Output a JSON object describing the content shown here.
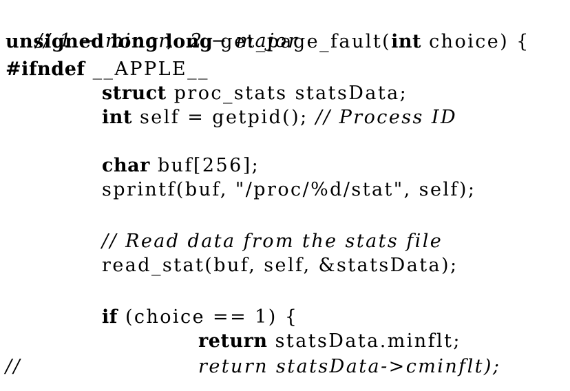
{
  "code": {
    "l1": {
      "comment": "// 1 − minor,  2 − major"
    },
    "l2": {
      "kw1": "unsigned long long",
      "rest": " get_page_fault(",
      "kw2": "int",
      "rest2": " choice) {"
    },
    "l3": {
      "kw": "#ifndef",
      "rest": " __APPLE__"
    },
    "l4": {
      "kw": "struct",
      "rest": " proc_stats statsData;"
    },
    "l5": {
      "kw": "int",
      "rest": " self = getpid(); ",
      "comment": "// Process ID"
    },
    "l6": {
      "kw": "char",
      "rest": " buf[256];"
    },
    "l7": {
      "text": "sprintf(buf, \"/proc/%d/stat\", self);"
    },
    "l8": {
      "comment": "// Read data from the stats file"
    },
    "l9": {
      "text": "read_stat(buf, self, &statsData);"
    },
    "l10": {
      "kw": "if",
      "rest": " (choice == 1) {"
    },
    "l11": {
      "kw": "return",
      "rest": " statsData.minflt;"
    },
    "l12": {
      "prefix": "//",
      "comment": "return statsData->cminflt);"
    }
  }
}
